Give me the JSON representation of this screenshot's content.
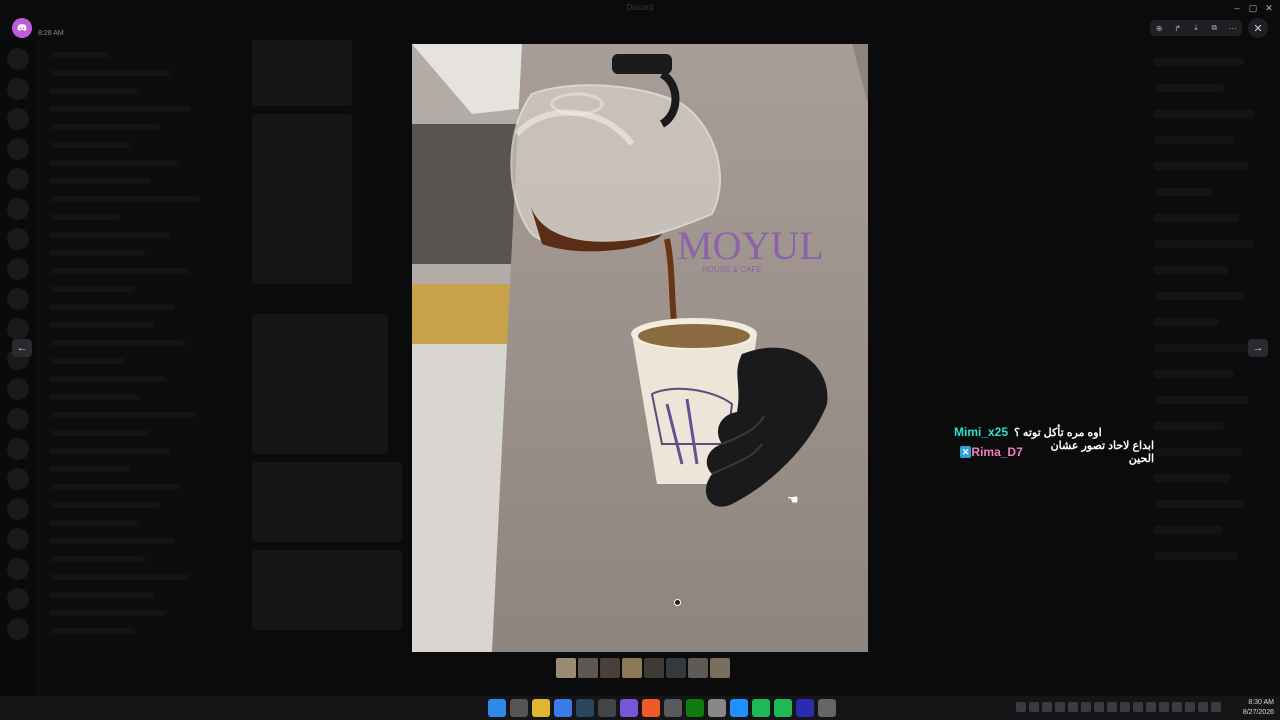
{
  "app": {
    "time": "8:28 AM"
  },
  "window": {
    "title": "Discord"
  },
  "toolbar": {
    "zoom_icon": "zoom-in-icon",
    "forward_icon": "share-icon",
    "download_icon": "download-icon",
    "open_icon": "external-link-icon",
    "more_icon": "more-icon"
  },
  "nav": {
    "prev": "←",
    "next": "→"
  },
  "photo": {
    "cup_text": "MOYUL",
    "apron_text": "HOUSE & CAFE"
  },
  "chat": {
    "messages": [
      {
        "user": "Mimi_x25",
        "text": "اوه مره تأكل توته ؟",
        "user_color": "#2fe0d0"
      },
      {
        "user": "Rima_D7",
        "text": "ابداع لاحاد تصور عشان الحين",
        "user_color": "#f080c0",
        "badge": "✕"
      }
    ]
  },
  "thumbnails": 8,
  "taskbar": {
    "time": "8:30 AM",
    "date": "8/27/2026"
  },
  "colors": {
    "discord": "#c25bd9",
    "viewer_bg": "#000000"
  }
}
